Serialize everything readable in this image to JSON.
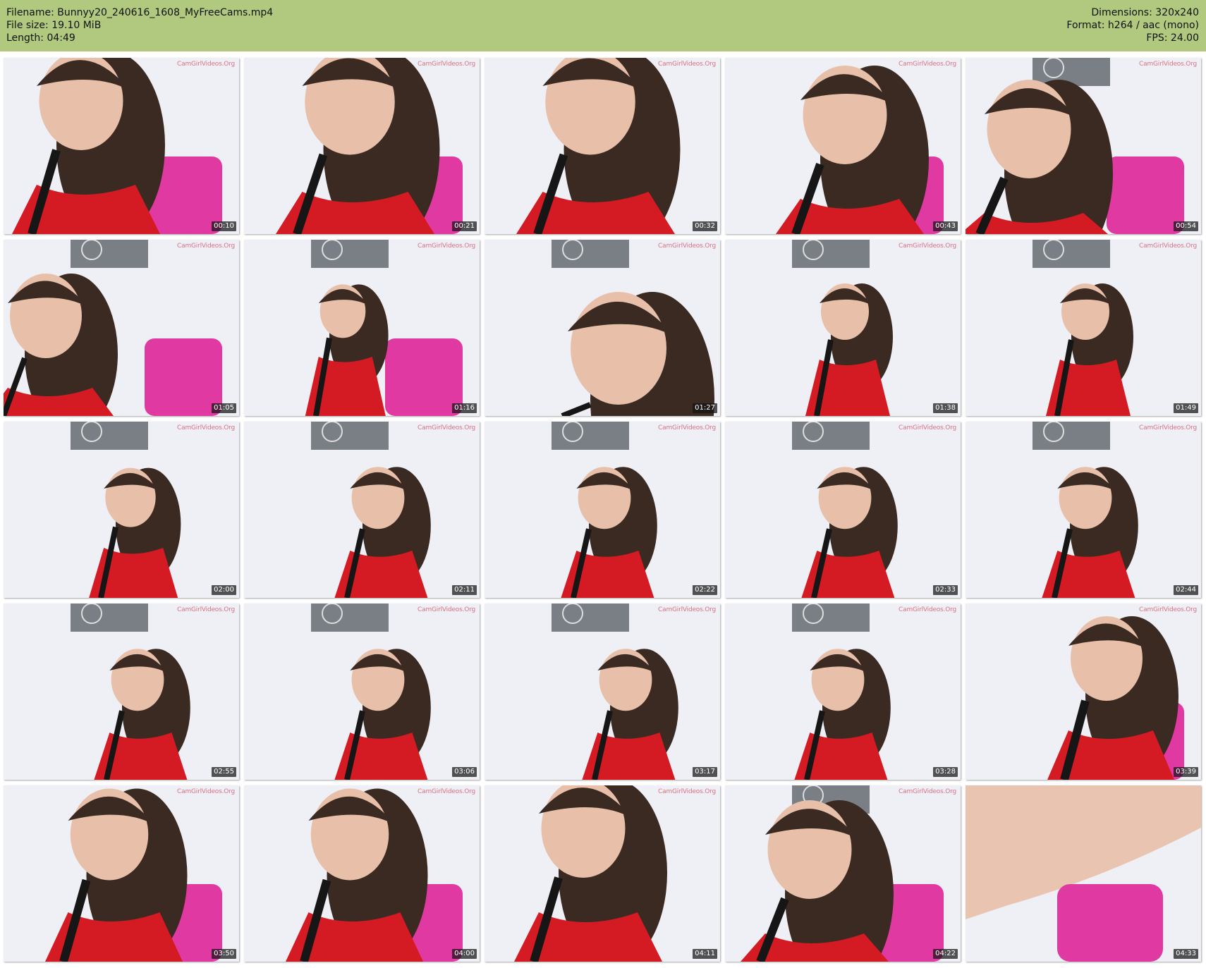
{
  "header": {
    "filename": "Filename: Bunnyy20_240616_1608_MyFreeCams.mp4",
    "filesize": "File size: 19.10 MiB",
    "length": "Length: 04:49",
    "dimensions": "Dimensions: 320x240",
    "format": "Format: h264 / aac (mono)",
    "fps": "FPS: 24.00"
  },
  "colors": {
    "header_bg": "#b0c97e",
    "wall": "#eef0f6",
    "hair": "#3a2a22",
    "skin": "#e8c0aa",
    "top_red": "#d41a22",
    "strap_black": "#161616",
    "towel_pink": "#e03aa2",
    "sign_gray": "#7a7f86"
  },
  "watermark": "CamGirlVideos.Org",
  "thumbnails": [
    {
      "ts": "00:10"
    },
    {
      "ts": "00:21"
    },
    {
      "ts": "00:32"
    },
    {
      "ts": "00:43"
    },
    {
      "ts": "00:54"
    },
    {
      "ts": "01:05"
    },
    {
      "ts": "01:16"
    },
    {
      "ts": "01:27"
    },
    {
      "ts": "01:38"
    },
    {
      "ts": "01:49"
    },
    {
      "ts": "02:00"
    },
    {
      "ts": "02:11"
    },
    {
      "ts": "02:22"
    },
    {
      "ts": "02:33"
    },
    {
      "ts": "02:44"
    },
    {
      "ts": "02:55"
    },
    {
      "ts": "03:06"
    },
    {
      "ts": "03:17"
    },
    {
      "ts": "03:28"
    },
    {
      "ts": "03:39"
    },
    {
      "ts": "03:50"
    },
    {
      "ts": "04:00"
    },
    {
      "ts": "04:11"
    },
    {
      "ts": "04:22"
    },
    {
      "ts": "04:33"
    }
  ]
}
